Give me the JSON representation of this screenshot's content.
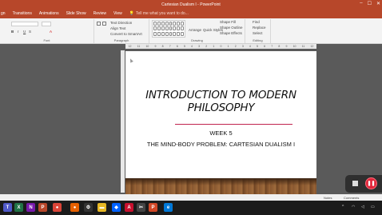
{
  "window": {
    "title": "Cartesian Dualism I - PowerPoint"
  },
  "tabs": [
    "gn",
    "Transitions",
    "Animations",
    "Slide Show",
    "Review",
    "View"
  ],
  "tell_me": "Tell me what you want to do...",
  "ribbon": {
    "groups": [
      {
        "label": "Font"
      },
      {
        "label": "Paragraph"
      },
      {
        "label": "Drawing"
      },
      {
        "label": "Editing"
      }
    ],
    "paragraph_items": [
      "Text Direction",
      "Align Text",
      "Convert to SmartArt"
    ],
    "drawing_items": [
      "Arrange",
      "Quick Styles",
      "Shape Fill",
      "Shape Outline",
      "Shape Effects"
    ],
    "editing_items": [
      "Find",
      "Replace",
      "Select"
    ]
  },
  "ruler_ticks": [
    "12",
    "11",
    "10",
    "9",
    "8",
    "7",
    "6",
    "5",
    "4",
    "3",
    "2",
    "1",
    "0",
    "1",
    "2",
    "3",
    "4",
    "5",
    "6",
    "7",
    "8",
    "9",
    "10",
    "11",
    "12"
  ],
  "slide": {
    "title": "INTRODUCTION TO MODERN PHILOSOPHY",
    "week": "WEEK 5",
    "subtitle": "THE MIND-BODY PROBLEM: CARTESIAN DUALISM I",
    "accent_color": "#c0244e"
  },
  "statusbar": {
    "notes": "Notes",
    "comments": "Comments"
  },
  "taskbar": {
    "apps": [
      {
        "name": "teams",
        "glyph": "T",
        "color": "#5059c9"
      },
      {
        "name": "excel",
        "glyph": "X",
        "color": "#217346"
      },
      {
        "name": "onenote",
        "glyph": "N",
        "color": "#7719aa"
      },
      {
        "name": "powerpoint",
        "glyph": "P",
        "color": "#b7472a"
      },
      {
        "name": "chrome",
        "glyph": "●",
        "color": "#db4437"
      },
      {
        "name": "firefox",
        "glyph": "●",
        "color": "#e66000"
      },
      {
        "name": "settings",
        "glyph": "⚙",
        "color": "#333333"
      },
      {
        "name": "file-explorer",
        "glyph": "▬",
        "color": "#e8b824"
      },
      {
        "name": "dropbox",
        "glyph": "◆",
        "color": "#0061ff"
      },
      {
        "name": "acrobat",
        "glyph": "A",
        "color": "#c8102e"
      },
      {
        "name": "snipping",
        "glyph": "✂",
        "color": "#444444"
      },
      {
        "name": "powerpoint-2",
        "glyph": "P",
        "color": "#d24726"
      },
      {
        "name": "edge",
        "glyph": "e",
        "color": "#0078d7"
      }
    ]
  }
}
